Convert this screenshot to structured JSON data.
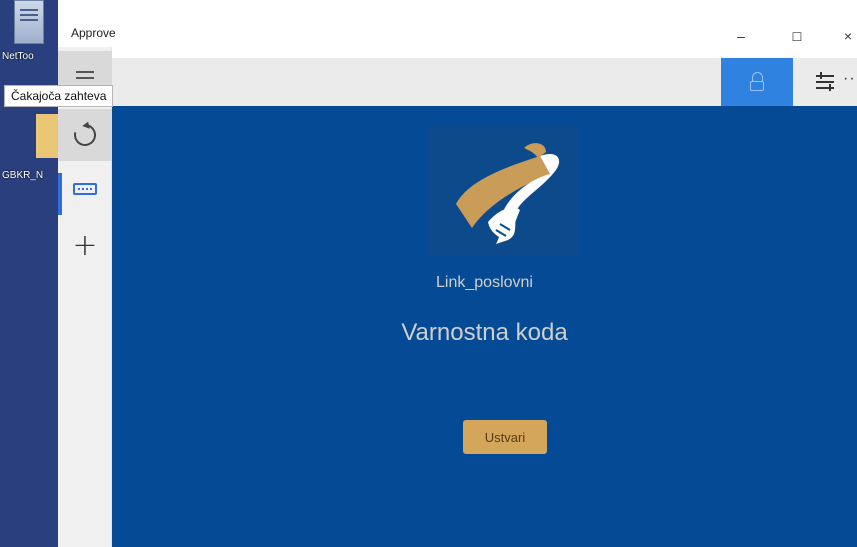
{
  "desktop": {
    "icon1_label": "NetToo",
    "icon2_label": "GBKR_N"
  },
  "window": {
    "title": "Approve",
    "minimize": "–",
    "maximize": "☐",
    "close": "×"
  },
  "tooltip": {
    "text": "Čakajoča zahteva"
  },
  "toolbar": {
    "more": "··"
  },
  "main": {
    "account_name": "Link_poslovni",
    "title": "Varnostna koda",
    "create_button": "Ustvari"
  },
  "colors": {
    "main_background": "#044a95",
    "accent_blue": "#2f82e0",
    "button_gold": "#d4a65c",
    "logo_gold": "#c99d57"
  },
  "icons": {
    "rail": [
      "hamburger-icon",
      "refresh-icon",
      "pending-request-icon",
      "add-icon"
    ],
    "toolbar": [
      "lock-icon",
      "settings-icon",
      "more-icon"
    ]
  }
}
